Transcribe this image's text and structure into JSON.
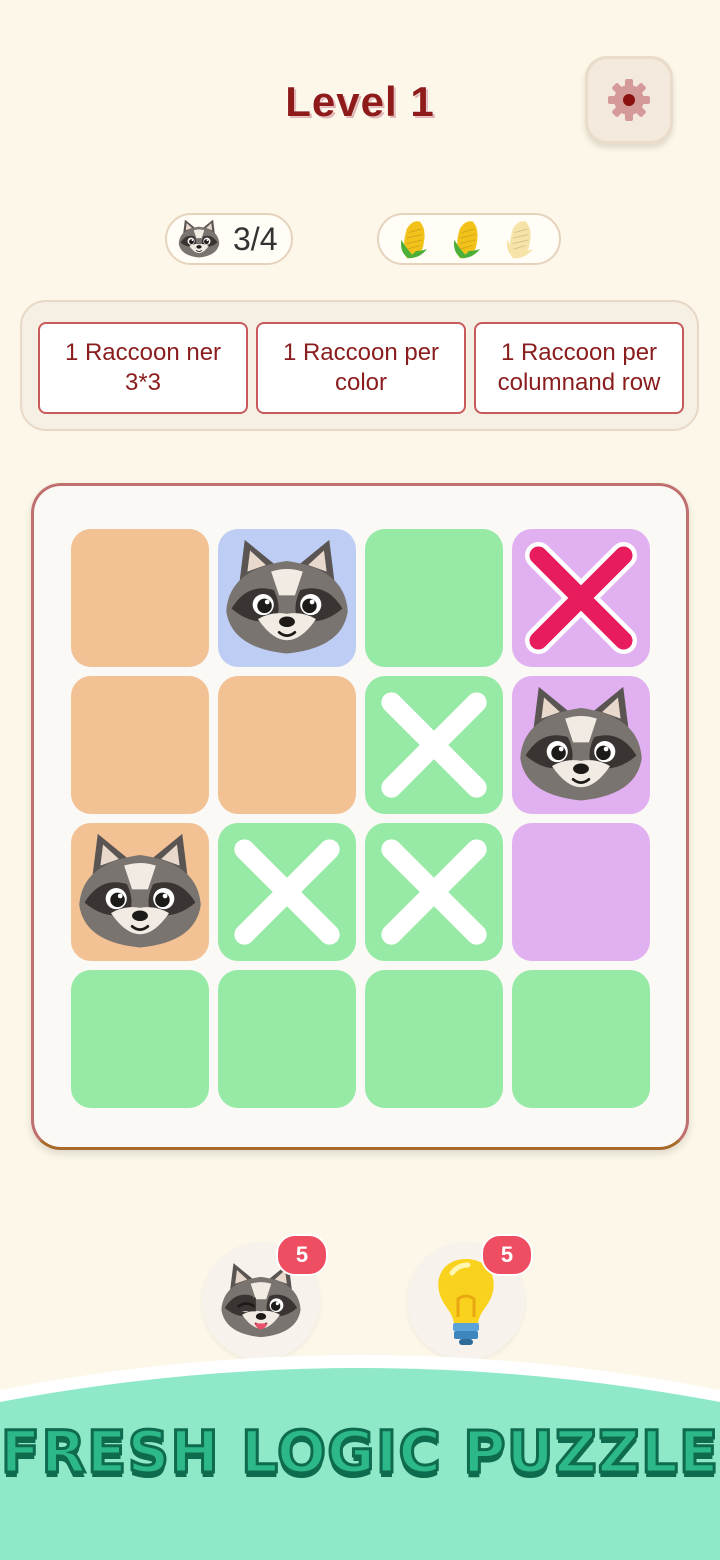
{
  "header": {
    "title": "Level 1",
    "settings_icon": "gear-icon"
  },
  "status": {
    "raccoon_count": "3/4",
    "corn_total": 3,
    "corn_earned": 2
  },
  "rules": [
    {
      "text": "1 Raccoon ner 3*3"
    },
    {
      "text": "1 Raccoon per color"
    },
    {
      "text": "1 Raccoon per columnand row"
    }
  ],
  "colors": {
    "peach": "#f2c194",
    "blue": "#bdcdf4",
    "green": "#96eaa6",
    "purple": "#e0b0f0",
    "red_cross": "#e81c5c",
    "white_cross": "#ffffff",
    "badge": "#ef4d62",
    "banner": "#8fe8c8"
  },
  "grid": [
    [
      {
        "color": "peach",
        "mark": "none"
      },
      {
        "color": "blue",
        "mark": "raccoon"
      },
      {
        "color": "green",
        "mark": "none"
      },
      {
        "color": "purple",
        "mark": "x-red"
      }
    ],
    [
      {
        "color": "peach",
        "mark": "none"
      },
      {
        "color": "peach",
        "mark": "none"
      },
      {
        "color": "green",
        "mark": "x"
      },
      {
        "color": "purple",
        "mark": "raccoon"
      }
    ],
    [
      {
        "color": "peach",
        "mark": "raccoon"
      },
      {
        "color": "green",
        "mark": "x"
      },
      {
        "color": "green",
        "mark": "x"
      },
      {
        "color": "purple",
        "mark": "none"
      }
    ],
    [
      {
        "color": "green",
        "mark": "none"
      },
      {
        "color": "green",
        "mark": "none"
      },
      {
        "color": "green",
        "mark": "none"
      },
      {
        "color": "green",
        "mark": "none"
      }
    ]
  ],
  "powerups": [
    {
      "icon": "winking-raccoon-icon",
      "count": "5"
    },
    {
      "icon": "lightbulb-icon",
      "count": "5"
    }
  ],
  "banner": {
    "text": "FRESH LOGIC PUZZLE"
  }
}
